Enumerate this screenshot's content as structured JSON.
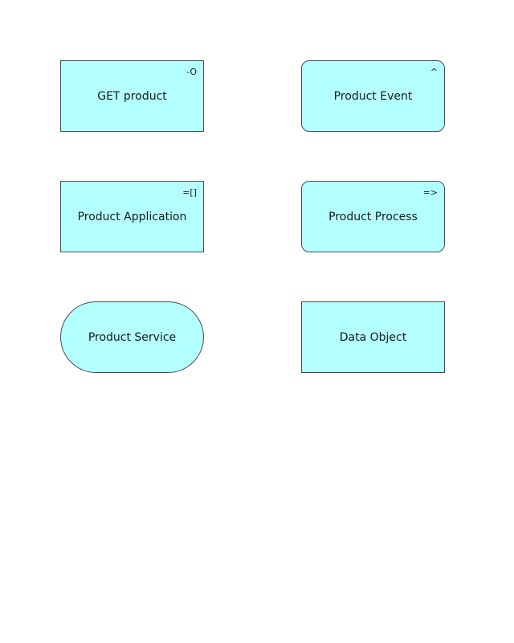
{
  "nodes": {
    "get_product": {
      "label": "GET product",
      "glyph": "-O",
      "glyph_name": "application-interface-icon"
    },
    "product_event": {
      "label": "Product Event",
      "glyph": "^",
      "glyph_name": "event-icon"
    },
    "product_application": {
      "label": "Product Application",
      "glyph": "=[]",
      "glyph_name": "application-component-icon"
    },
    "product_process": {
      "label": "Product Process",
      "glyph": "=>",
      "glyph_name": "process-icon"
    },
    "product_service": {
      "label": "Product Service"
    },
    "data_object": {
      "label": "Data Object"
    }
  },
  "colors": {
    "node_fill": "#b3ffff",
    "node_stroke": "#4d4d4d",
    "text": "#1a1a1a"
  }
}
